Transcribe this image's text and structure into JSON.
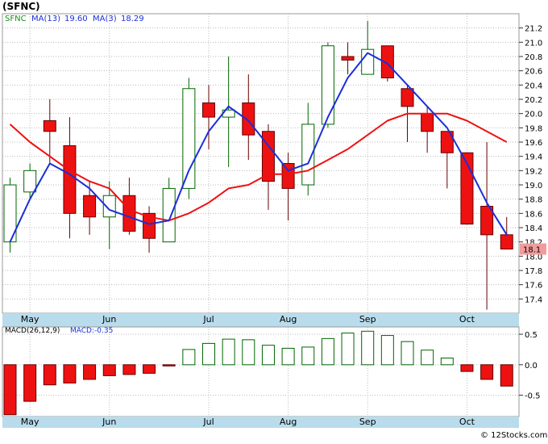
{
  "title": "(SFNC)",
  "watermark": "© 12Stocks.com",
  "chart_data": [
    {
      "type": "candlestick",
      "legend": {
        "symbol": "SFNC",
        "ma_fast_label": "MA(13)",
        "ma_fast_value": "19.60",
        "ma_slow_label": "MA(3)",
        "ma_slow_value": "18.29"
      },
      "x_labels": [
        {
          "label": "May",
          "index": 1
        },
        {
          "label": "Jun",
          "index": 5
        },
        {
          "label": "Jul",
          "index": 10
        },
        {
          "label": "Aug",
          "index": 14
        },
        {
          "label": "Sep",
          "index": 18
        },
        {
          "label": "Oct",
          "index": 23
        }
      ],
      "y_ticks": [
        "17.4",
        "17.6",
        "17.8",
        "18.0",
        "18.2",
        "18.4",
        "18.6",
        "18.8",
        "19.0",
        "19.2",
        "19.4",
        "19.6",
        "19.8",
        "20.0",
        "20.2",
        "20.4",
        "20.6",
        "20.8",
        "21.0",
        "21.2"
      ],
      "ylim": [
        17.2,
        21.4
      ],
      "last_price": "18.1",
      "candles": [
        {
          "o": 18.2,
          "h": 19.1,
          "l": 18.05,
          "c": 19.0
        },
        {
          "o": 18.9,
          "h": 19.3,
          "l": 18.8,
          "c": 19.2
        },
        {
          "o": 19.9,
          "h": 20.2,
          "l": 19.3,
          "c": 19.75
        },
        {
          "o": 19.55,
          "h": 19.95,
          "l": 18.25,
          "c": 18.6
        },
        {
          "o": 18.85,
          "h": 19.05,
          "l": 18.3,
          "c": 18.55
        },
        {
          "o": 18.55,
          "h": 19.05,
          "l": 18.1,
          "c": 18.85
        },
        {
          "o": 18.85,
          "h": 19.1,
          "l": 18.3,
          "c": 18.35
        },
        {
          "o": 18.6,
          "h": 18.7,
          "l": 18.05,
          "c": 18.25
        },
        {
          "o": 18.2,
          "h": 19.1,
          "l": 18.2,
          "c": 18.95
        },
        {
          "o": 18.95,
          "h": 20.5,
          "l": 18.8,
          "c": 20.35
        },
        {
          "o": 20.15,
          "h": 20.4,
          "l": 19.5,
          "c": 19.95
        },
        {
          "o": 19.95,
          "h": 20.8,
          "l": 19.25,
          "c": 20.05
        },
        {
          "o": 20.15,
          "h": 20.55,
          "l": 19.35,
          "c": 19.7
        },
        {
          "o": 19.75,
          "h": 19.85,
          "l": 18.65,
          "c": 19.05
        },
        {
          "o": 19.3,
          "h": 19.45,
          "l": 18.5,
          "c": 18.95
        },
        {
          "o": 19.0,
          "h": 20.15,
          "l": 18.85,
          "c": 19.85
        },
        {
          "o": 19.85,
          "h": 21.0,
          "l": 19.8,
          "c": 20.95
        },
        {
          "o": 20.8,
          "h": 21.0,
          "l": 20.55,
          "c": 20.75
        },
        {
          "o": 20.55,
          "h": 21.3,
          "l": 20.55,
          "c": 20.9
        },
        {
          "o": 20.95,
          "h": 20.95,
          "l": 20.45,
          "c": 20.5
        },
        {
          "o": 20.35,
          "h": 20.4,
          "l": 19.6,
          "c": 20.1
        },
        {
          "o": 20.0,
          "h": 20.1,
          "l": 19.45,
          "c": 19.75
        },
        {
          "o": 19.75,
          "h": 19.75,
          "l": 18.95,
          "c": 19.45
        },
        {
          "o": 19.45,
          "h": 19.45,
          "l": 18.45,
          "c": 18.45
        },
        {
          "o": 18.7,
          "h": 19.6,
          "l": 17.25,
          "c": 18.3
        },
        {
          "o": 18.3,
          "h": 18.55,
          "l": 18.1,
          "c": 18.1
        }
      ],
      "ma_fast": [
        {
          "i": 0,
          "v": 19.85
        },
        {
          "i": 1,
          "v": 19.6
        },
        {
          "i": 2,
          "v": 19.4
        },
        {
          "i": 3,
          "v": 19.2
        },
        {
          "i": 4,
          "v": 19.05
        },
        {
          "i": 5,
          "v": 18.95
        },
        {
          "i": 6,
          "v": 18.65
        },
        {
          "i": 7,
          "v": 18.55
        },
        {
          "i": 8,
          "v": 18.5
        },
        {
          "i": 9,
          "v": 18.6
        },
        {
          "i": 10,
          "v": 18.75
        },
        {
          "i": 11,
          "v": 18.95
        },
        {
          "i": 12,
          "v": 19.0
        },
        {
          "i": 13,
          "v": 19.15
        },
        {
          "i": 14,
          "v": 19.15
        },
        {
          "i": 15,
          "v": 19.2
        },
        {
          "i": 16,
          "v": 19.35
        },
        {
          "i": 17,
          "v": 19.5
        },
        {
          "i": 18,
          "v": 19.7
        },
        {
          "i": 19,
          "v": 19.9
        },
        {
          "i": 20,
          "v": 20.0
        },
        {
          "i": 21,
          "v": 20.0
        },
        {
          "i": 22,
          "v": 20.0
        },
        {
          "i": 23,
          "v": 19.9
        },
        {
          "i": 24,
          "v": 19.75
        },
        {
          "i": 25,
          "v": 19.6
        }
      ],
      "ma_slow": [
        {
          "i": 0,
          "v": 18.2
        },
        {
          "i": 1,
          "v": 18.8
        },
        {
          "i": 2,
          "v": 19.3
        },
        {
          "i": 3,
          "v": 19.15
        },
        {
          "i": 4,
          "v": 18.95
        },
        {
          "i": 5,
          "v": 18.65
        },
        {
          "i": 6,
          "v": 18.55
        },
        {
          "i": 7,
          "v": 18.45
        },
        {
          "i": 8,
          "v": 18.5
        },
        {
          "i": 9,
          "v": 19.2
        },
        {
          "i": 10,
          "v": 19.75
        },
        {
          "i": 11,
          "v": 20.1
        },
        {
          "i": 12,
          "v": 19.9
        },
        {
          "i": 13,
          "v": 19.55
        },
        {
          "i": 14,
          "v": 19.2
        },
        {
          "i": 15,
          "v": 19.3
        },
        {
          "i": 16,
          "v": 19.95
        },
        {
          "i": 17,
          "v": 20.5
        },
        {
          "i": 18,
          "v": 20.85
        },
        {
          "i": 19,
          "v": 20.7
        },
        {
          "i": 20,
          "v": 20.4
        },
        {
          "i": 21,
          "v": 20.1
        },
        {
          "i": 22,
          "v": 19.8
        },
        {
          "i": 23,
          "v": 19.3
        },
        {
          "i": 24,
          "v": 18.75
        },
        {
          "i": 25,
          "v": 18.3
        }
      ],
      "colors": {
        "up_body": "#ffffff",
        "up_outline": "#006600",
        "down_body": "#ee1111",
        "down_outline": "#660000",
        "ma_fast": "#ee1111",
        "ma_slow": "#1a2fd9",
        "grid": "#bbbbbb",
        "axis_band": "#b8dcec",
        "last_price_bg": "#f29b9b"
      }
    },
    {
      "type": "bar",
      "legend": {
        "label": "MACD(26,12,9)",
        "value_label": "MACD:-0.35"
      },
      "y_ticks": [
        "0.5",
        "0.0",
        "-0.5"
      ],
      "ylim": [
        -0.85,
        0.62
      ],
      "values": [
        -0.82,
        -0.6,
        -0.33,
        -0.3,
        -0.24,
        -0.18,
        -0.16,
        -0.14,
        -0.02,
        0.25,
        0.35,
        0.42,
        0.41,
        0.32,
        0.27,
        0.29,
        0.43,
        0.52,
        0.55,
        0.48,
        0.38,
        0.24,
        0.11,
        -0.11,
        -0.24,
        -0.35
      ],
      "colors": {
        "positive": "#006600",
        "negative_fill": "#ee1111",
        "negative_outline": "#660000"
      }
    }
  ]
}
